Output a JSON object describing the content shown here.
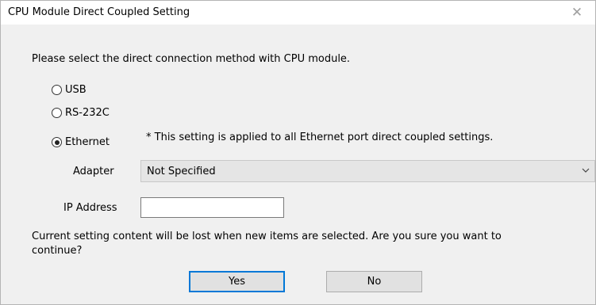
{
  "window": {
    "title": "CPU Module Direct Coupled Setting",
    "close_glyph": "✕"
  },
  "dialog": {
    "prompt": "Please select the direct connection method with CPU module.",
    "methods": [
      {
        "label": "USB",
        "selected": false
      },
      {
        "label": "RS-232C",
        "selected": false
      },
      {
        "label": "Ethernet",
        "selected": true
      }
    ],
    "ethernet_note": "* This setting is applied to all Ethernet port direct coupled settings.",
    "adapter": {
      "label": "Adapter",
      "value": "Not Specified"
    },
    "ip_address": {
      "label": "IP Address",
      "value": ""
    },
    "warning_line1": "Current setting content will be lost when new items are selected. Are you sure you want to",
    "warning_line2": "continue?",
    "buttons": {
      "yes": "Yes",
      "no": "No"
    }
  },
  "colors": {
    "client_bg": "#f0f0f0",
    "button_bg": "#e1e1e1",
    "default_button_border": "#0078d7"
  }
}
